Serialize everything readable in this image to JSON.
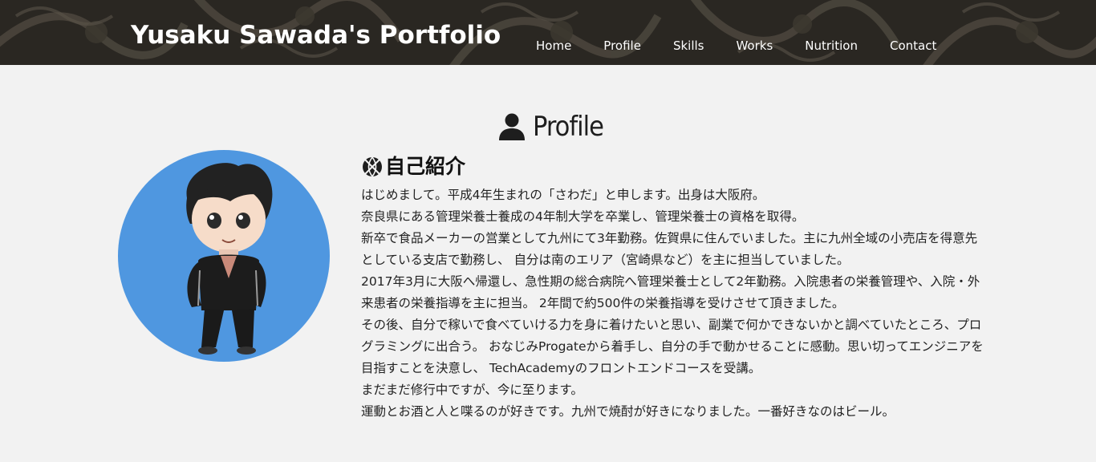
{
  "header": {
    "site_title": "Yusaku Sawada's Portfolio",
    "nav": [
      {
        "label": "Home"
      },
      {
        "label": "Profile"
      },
      {
        "label": "Skills"
      },
      {
        "label": "Works"
      },
      {
        "label": "Nutrition"
      },
      {
        "label": "Contact"
      }
    ]
  },
  "profile": {
    "heading": "Profile",
    "heading_icon": "user-icon",
    "sub_heading": "自己紹介",
    "sub_heading_icon": "basketball-icon",
    "avatar": "cartoon-portrait",
    "paragraphs": [
      "はじめまして。平成4年生まれの「さわだ」と申します。出身は大阪府。",
      "奈良県にある管理栄養士養成の4年制大学を卒業し、管理栄養士の資格を取得。",
      "新卒で食品メーカーの営業として九州にて3年勤務。佐賀県に住んでいました。主に九州全域の小売店を得意先としている支店で勤務し、 自分は南のエリア（宮崎県など）を主に担当していました。",
      "2017年3月に大阪へ帰還し、急性期の総合病院へ管理栄養士として2年勤務。入院患者の栄養管理や、入院・外来患者の栄養指導を主に担当。 2年間で約500件の栄養指導を受けさせて頂きました。",
      "その後、自分で稼いで食べていける力を身に着けたいと思い、副業で何かできないかと調べていたところ、プログラミングに出合う。 おなじみProgateから着手し、自分の手で動かせることに感動。思い切ってエンジニアを目指すことを決意し、 TechAcademyのフロントエンドコースを受講。",
      "まだまだ修行中ですが、今に至ります。",
      "運動とお酒と人と喋るのが好きです。九州で焼酎が好きになりました。一番好きなのはビール。"
    ]
  },
  "colors": {
    "header_bg": "#2a2722",
    "page_bg": "#f2f2f2",
    "avatar_bg": "#4f97e0"
  }
}
